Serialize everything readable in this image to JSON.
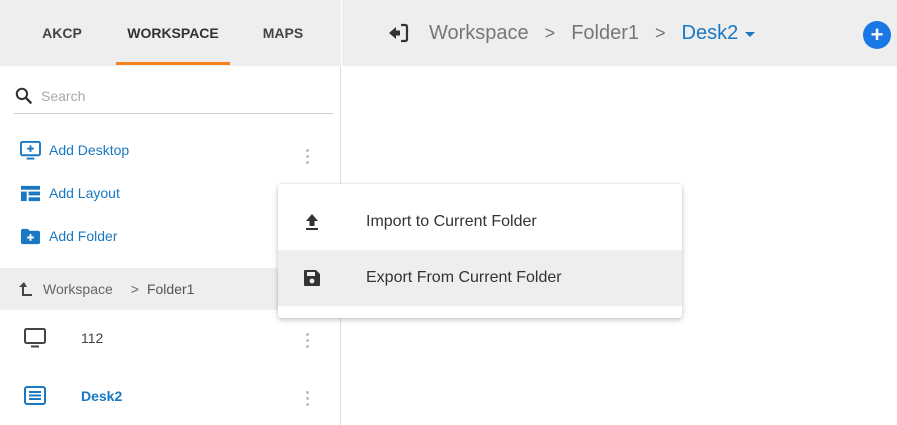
{
  "tabs": [
    {
      "label": "AKCP"
    },
    {
      "label": "WORKSPACE"
    },
    {
      "label": "MAPS"
    }
  ],
  "search": {
    "placeholder": "Search"
  },
  "actions": {
    "add_desktop": "Add Desktop",
    "add_layout": "Add Layout",
    "add_folder": "Add Folder"
  },
  "crumb": {
    "root": "Workspace",
    "separator": ">",
    "current": "Folder1"
  },
  "items": [
    {
      "label": "112"
    },
    {
      "label": "Desk2"
    }
  ],
  "header": {
    "crumbs": [
      "Workspace",
      "Folder1"
    ],
    "separator": ">",
    "current": "Desk2",
    "add_symbol": "+"
  },
  "menu": {
    "import": "Import to Current Folder",
    "export": "Export From Current Folder"
  },
  "colors": {
    "accent": "#1a78c2",
    "tab_underline": "#f5821f",
    "panel_bg": "#eeeeee"
  }
}
